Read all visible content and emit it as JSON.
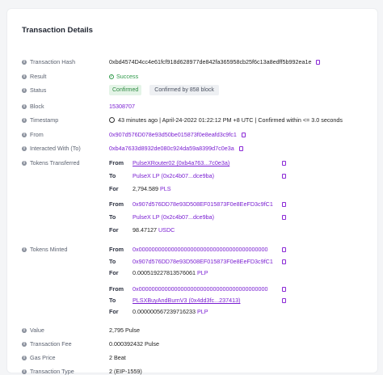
{
  "title": "Transaction Details",
  "fields": {
    "tx_hash": {
      "label": "Transaction Hash",
      "value": "0xbd4574D4cc4e61fcf918d628977de842fa365958cb25f6c13a8edff5b992ea1e"
    },
    "result": {
      "label": "Result",
      "value": "Success"
    },
    "status": {
      "label": "Status",
      "badge": "Confirmed",
      "blocks": "Confirmed by 858 block"
    },
    "block": {
      "label": "Block",
      "value": "15308707"
    },
    "timestamp": {
      "label": "Timestamp",
      "value": "43 minutes ago | April-24-2022 01:22:12 PM +8 UTC | Confirmed within <= 3.0 seconds"
    },
    "from": {
      "label": "From",
      "value": "0x907d576D078e93d50be015873f0e8eafd3c9fc1"
    },
    "interacted": {
      "label": "Interacted With (To)",
      "value": "0xb4a7633d8932de080c924da59a8399d7c0e3a"
    },
    "tokens_transferred": {
      "label": "Tokens Transferred",
      "groups": [
        {
          "from": "PulseXRouter02 (0xb4a763...7c0e3a)",
          "to": "PulseX LP (0x2c4b07...dce9ba)",
          "for_amount": "2,794.589",
          "for_token": "PLS"
        },
        {
          "from": "0x907d576DD78e93D508EF015873F0e8EeFD3c9fC1",
          "to": "PulseX LP (0x2c4b07...dce9ba)",
          "for_amount": "98.47127",
          "for_token": "USDC"
        }
      ]
    },
    "tokens_minted": {
      "label": "Tokens Minted",
      "groups": [
        {
          "from": "0x0000000000000000000000000000000000000000",
          "to": "0x907d576DD78e93D508EF015873F0e8EeFD3c9fC1",
          "for_amount": "0.000519227813576061",
          "for_token": "PLP"
        },
        {
          "from": "0x0000000000000000000000000000000000000000",
          "to": "PLSXBuyAndBurnV3 (0x4dd3fc...237413)",
          "for_amount": "0.000000567239716233",
          "for_token": "PLP"
        }
      ]
    },
    "value": {
      "label": "Value",
      "value": "2,795 Pulse"
    },
    "fee": {
      "label": "Transaction Fee",
      "value": "0.000392432 Pulse"
    },
    "gas": {
      "label": "Gas Price",
      "value": "2 Beat"
    },
    "type": {
      "label": "Transaction Type",
      "value": "2 (EIP-1559)"
    }
  },
  "row_keys": {
    "from": "From",
    "to": "To",
    "for": "For"
  },
  "icons": {
    "info": "info-icon",
    "copy": "copy-icon",
    "check": "check-circle-icon",
    "clock": "clock-icon"
  },
  "colors": {
    "link": "#7a1fd2",
    "success": "#2f9a4a"
  }
}
